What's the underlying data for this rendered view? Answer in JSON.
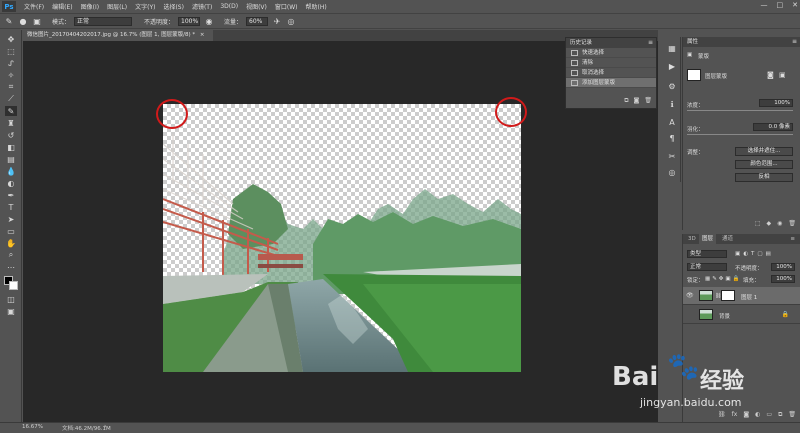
{
  "menubar": {
    "logo": "Ps",
    "items": [
      "文件(F)",
      "编辑(E)",
      "图像(I)",
      "图层(L)",
      "文字(Y)",
      "选择(S)",
      "滤镜(T)",
      "3D(D)",
      "视图(V)",
      "窗口(W)",
      "帮助(H)"
    ],
    "window_buttons": [
      "—",
      "□",
      "✕"
    ]
  },
  "options": {
    "mode_label": "模式：",
    "mode_value": "正常",
    "opacity_label": "不透明度：",
    "opacity_value": "100%",
    "flow_label": "流量：",
    "flow_value": "60%"
  },
  "document": {
    "tab_title": "微信图片_20170404202017.jpg @ 16.7% (图层 1, 图层蒙版/8) *",
    "tab_close": "×"
  },
  "history": {
    "title": "历史记录",
    "items": [
      "快速选择",
      "清除",
      "取消选择",
      "添加图层蒙版"
    ]
  },
  "properties": {
    "title": "属性",
    "mask_type": "蒙版",
    "mask_name": "图层蒙版",
    "density_label": "浓度：",
    "density_value": "100%",
    "feather_label": "羽化：",
    "feather_value": "0.0 像素",
    "adjust_label": "调整：",
    "btn_select": "选择并遮住...",
    "btn_color_range": "颜色范围...",
    "btn_invert": "反相"
  },
  "layers": {
    "tabs": [
      "3D",
      "图层",
      "通道"
    ],
    "kind_label": "类型",
    "blend_mode": "正常",
    "opacity_label": "不透明度：",
    "opacity_value": "100%",
    "lock_label": "锁定：",
    "fill_label": "填充：",
    "fill_value": "100%",
    "rows": [
      {
        "name": "图层 1"
      },
      {
        "name": "背景"
      }
    ]
  },
  "status": {
    "zoom": "16.67%",
    "doc_info": "文档:46.2M/96.1M"
  },
  "watermark": {
    "brand": "Bai",
    "brand2": "经验",
    "url": "jingyan.baidu.com"
  },
  "colors": {
    "annotation": "#d11a1a",
    "panel": "#535353",
    "canvas_bg": "#282828"
  }
}
